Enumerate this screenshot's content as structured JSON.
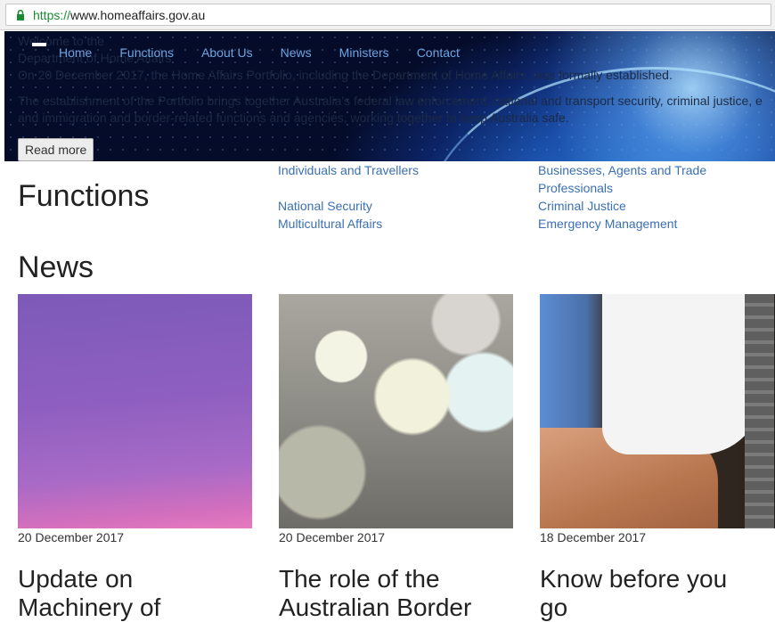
{
  "browser": {
    "url_scheme": "https://",
    "url_host": "www.homeaffairs.gov.au"
  },
  "hero": {
    "nav": [
      "Home",
      "Functions",
      "About Us",
      "News",
      "Ministers",
      "Contact"
    ],
    "welcome_line1": "Welcome to the",
    "welcome_line2": "Department of Home Affairs",
    "para1": "On 20 December 2017, the Home Affairs Portfolio, including the Department of Home Affairs, was formally established.",
    "para2_line1": "The establishment of the Portfolio brings together Australia's federal law enforcement, national and transport security, criminal justice, e",
    "para2_line2": "and immigration and border-related functions and agencies, working together to keep Australia safe.",
    "read_more": "Read more"
  },
  "functions": {
    "title": "Functions",
    "links": [
      "Individuals and Travellers",
      "Businesses, Agents and Trade",
      "Professionals",
      "National Security",
      "Criminal Justice",
      "Multicultural Affairs",
      "Emergency Management"
    ]
  },
  "news": {
    "title": "News",
    "items": [
      {
        "date": "20 December 2017",
        "title_line1": "Update on",
        "title_line2": "Machinery of"
      },
      {
        "date": "20 December 2017",
        "title_line1": "The role of the",
        "title_line2": "Australian Border"
      },
      {
        "date": "18 December 2017",
        "title_line1": "Know before you",
        "title_line2": "go"
      }
    ]
  },
  "colors": {
    "link": "#3b6fb4",
    "nav_link": "#6ea4e0",
    "secure_green": "#1a8a34"
  }
}
